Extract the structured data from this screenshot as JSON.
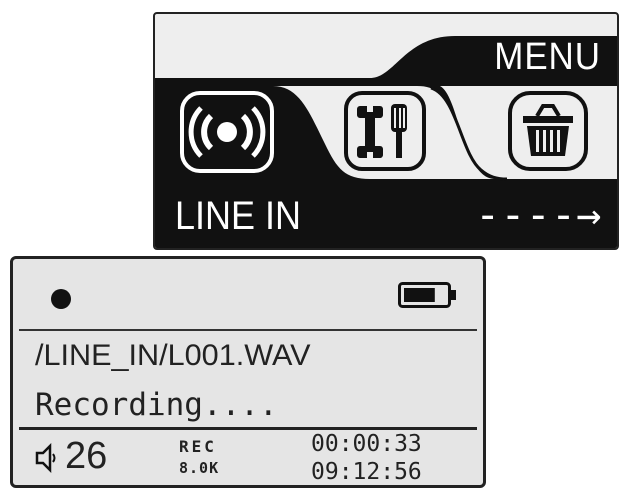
{
  "menu_screen": {
    "title": "MENU",
    "selected_mode": "LINE IN",
    "next_indicator": "----→",
    "icons": [
      "line-in-radio-icon",
      "tools-settings-icon",
      "trash-delete-icon"
    ]
  },
  "recording_screen": {
    "status_icon": "record-dot-icon",
    "battery_level": 0.75,
    "file_path": "/LINE_IN/L001.WAV",
    "status": "Recording....",
    "volume": "26",
    "mode_label": "REC",
    "sample_rate": "8.0K",
    "elapsed_time": "00:00:33",
    "remaining_time": "09:12:56"
  },
  "colors": {
    "screen_bg": "#e5e5e5",
    "ink": "#111111"
  }
}
